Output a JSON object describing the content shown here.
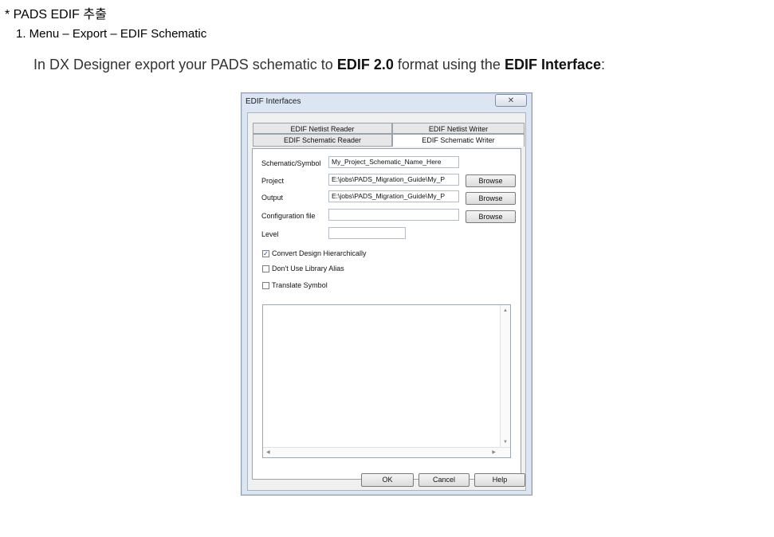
{
  "slide": {
    "title": "* PADS EDIF 추출",
    "step": "1. Menu – Export – EDIF Schematic",
    "desc_prefix": "In DX Designer export your PADS schematic to ",
    "desc_bold1": "EDIF 2.0",
    "desc_mid": " format using the ",
    "desc_bold2": "EDIF Interface",
    "desc_suffix": ":"
  },
  "dialog": {
    "title": "EDIF Interfaces",
    "close_glyph": "✕",
    "tabs_top": [
      "EDIF Netlist Reader",
      "EDIF Netlist Writer"
    ],
    "tabs_bottom": [
      "EDIF Schematic Reader",
      "EDIF Schematic Writer"
    ],
    "active_tab": "EDIF Schematic Writer",
    "fields": {
      "schematic_label": "Schematic/Symbol",
      "schematic_value": "My_Project_Schematic_Name_Here",
      "project_label": "Project",
      "project_value": "E:\\jobs\\PADS_Migration_Guide\\My_P",
      "output_label": "Output",
      "output_value": "E:\\jobs\\PADS_Migration_Guide\\My_P",
      "config_label": "Configuration file",
      "config_value": "",
      "level_label": "Level",
      "level_value": ""
    },
    "browse_label": "Browse",
    "checkboxes": [
      {
        "label": "Convert Design Hierarchically",
        "checked": true
      },
      {
        "label": "Don't Use Library Alias",
        "checked": false
      },
      {
        "label": "Translate Symbol",
        "checked": false
      }
    ],
    "check_glyph": "✓",
    "buttons": {
      "ok": "OK",
      "cancel": "Cancel",
      "help": "Help"
    }
  }
}
